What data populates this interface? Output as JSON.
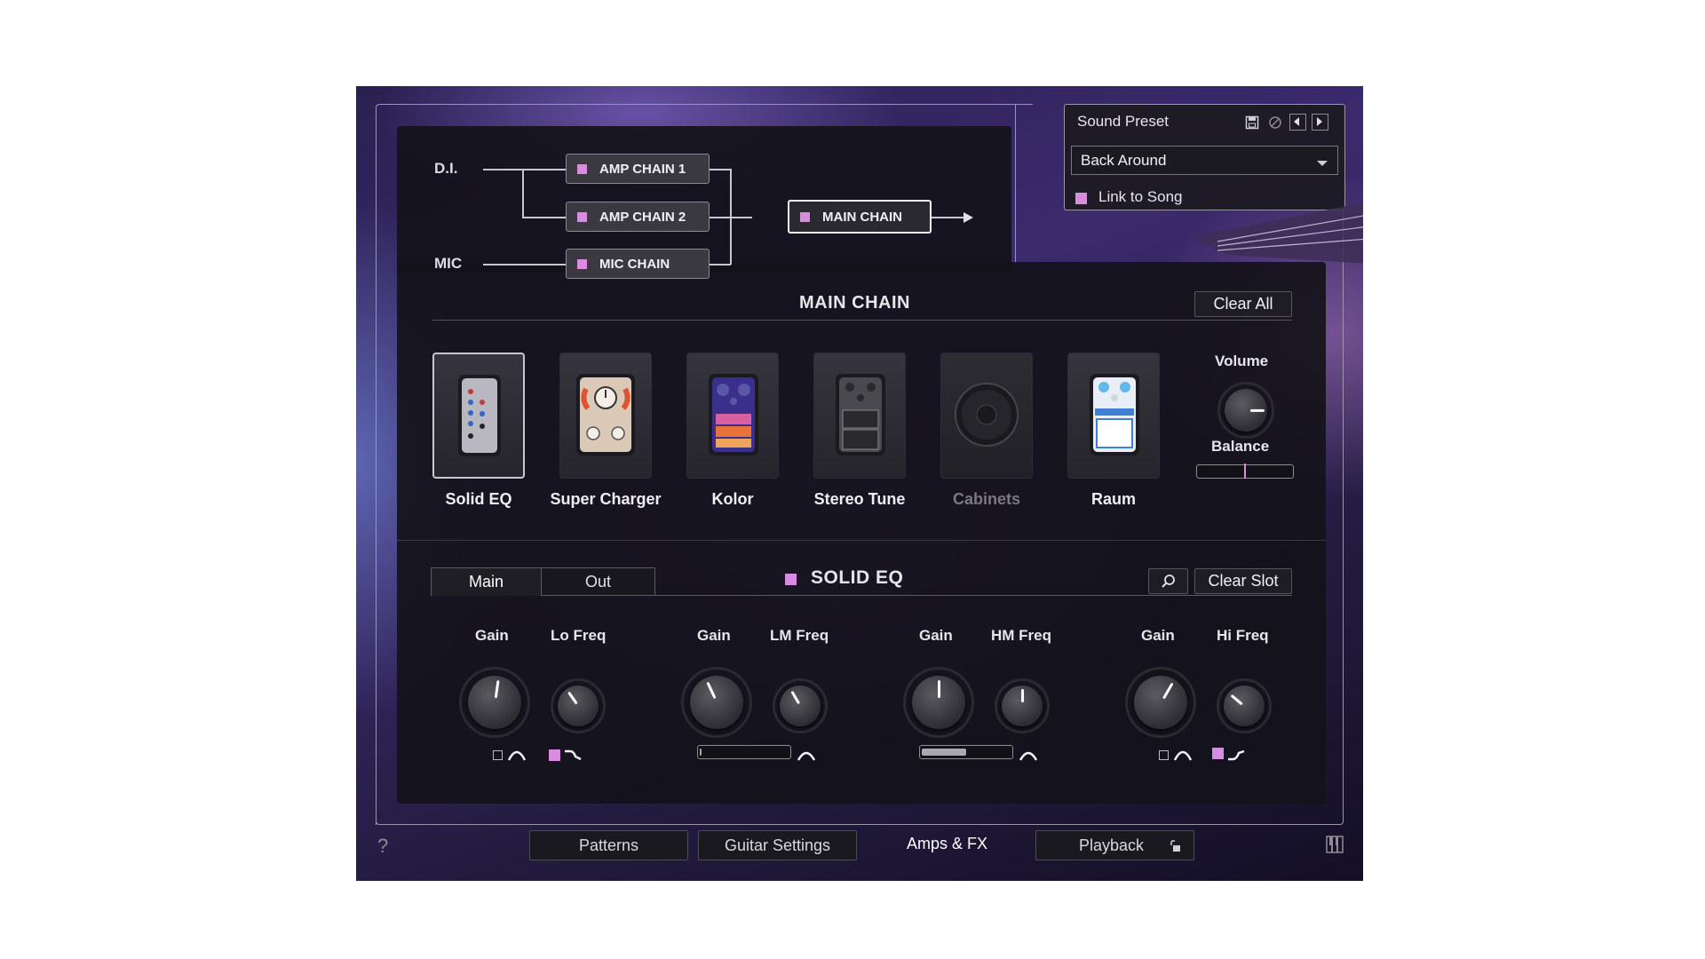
{
  "routing": {
    "di_label": "D.I.",
    "mic_label": "MIC",
    "amp_chain_1": "AMP CHAIN 1",
    "amp_chain_2": "AMP CHAIN 2",
    "mic_chain": "MIC CHAIN",
    "main_chain": "MAIN CHAIN"
  },
  "preset": {
    "title": "Sound Preset",
    "selected": "Back Around",
    "link_label": "Link to Song",
    "link_checked": true
  },
  "main_chain": {
    "title": "MAIN CHAIN",
    "clear_all": "Clear All",
    "pedals": [
      {
        "name": "Solid EQ",
        "selected": true,
        "enabled": true
      },
      {
        "name": "Super Charger",
        "selected": false,
        "enabled": true
      },
      {
        "name": "Kolor",
        "selected": false,
        "enabled": true
      },
      {
        "name": "Stereo Tune",
        "selected": false,
        "enabled": true
      },
      {
        "name": "Cabinets",
        "selected": false,
        "enabled": false
      },
      {
        "name": "Raum",
        "selected": false,
        "enabled": true
      }
    ],
    "volume_label": "Volume",
    "balance_label": "Balance"
  },
  "editor": {
    "tabs": [
      "Main",
      "Out"
    ],
    "active_tab": "Main",
    "title": "SOLID EQ",
    "clear_slot": "Clear Slot",
    "bands": [
      {
        "gain_label": "Gain",
        "freq_label": "Lo Freq"
      },
      {
        "gain_label": "Gain",
        "freq_label": "LM Freq"
      },
      {
        "gain_label": "Gain",
        "freq_label": "HM Freq"
      },
      {
        "gain_label": "Gain",
        "freq_label": "Hi Freq"
      }
    ]
  },
  "bottom_tabs": {
    "patterns": "Patterns",
    "guitar_settings": "Guitar Settings",
    "amps_fx": "Amps & FX",
    "playback": "Playback",
    "help": "?"
  },
  "colors": {
    "accent": "#d98be0"
  }
}
